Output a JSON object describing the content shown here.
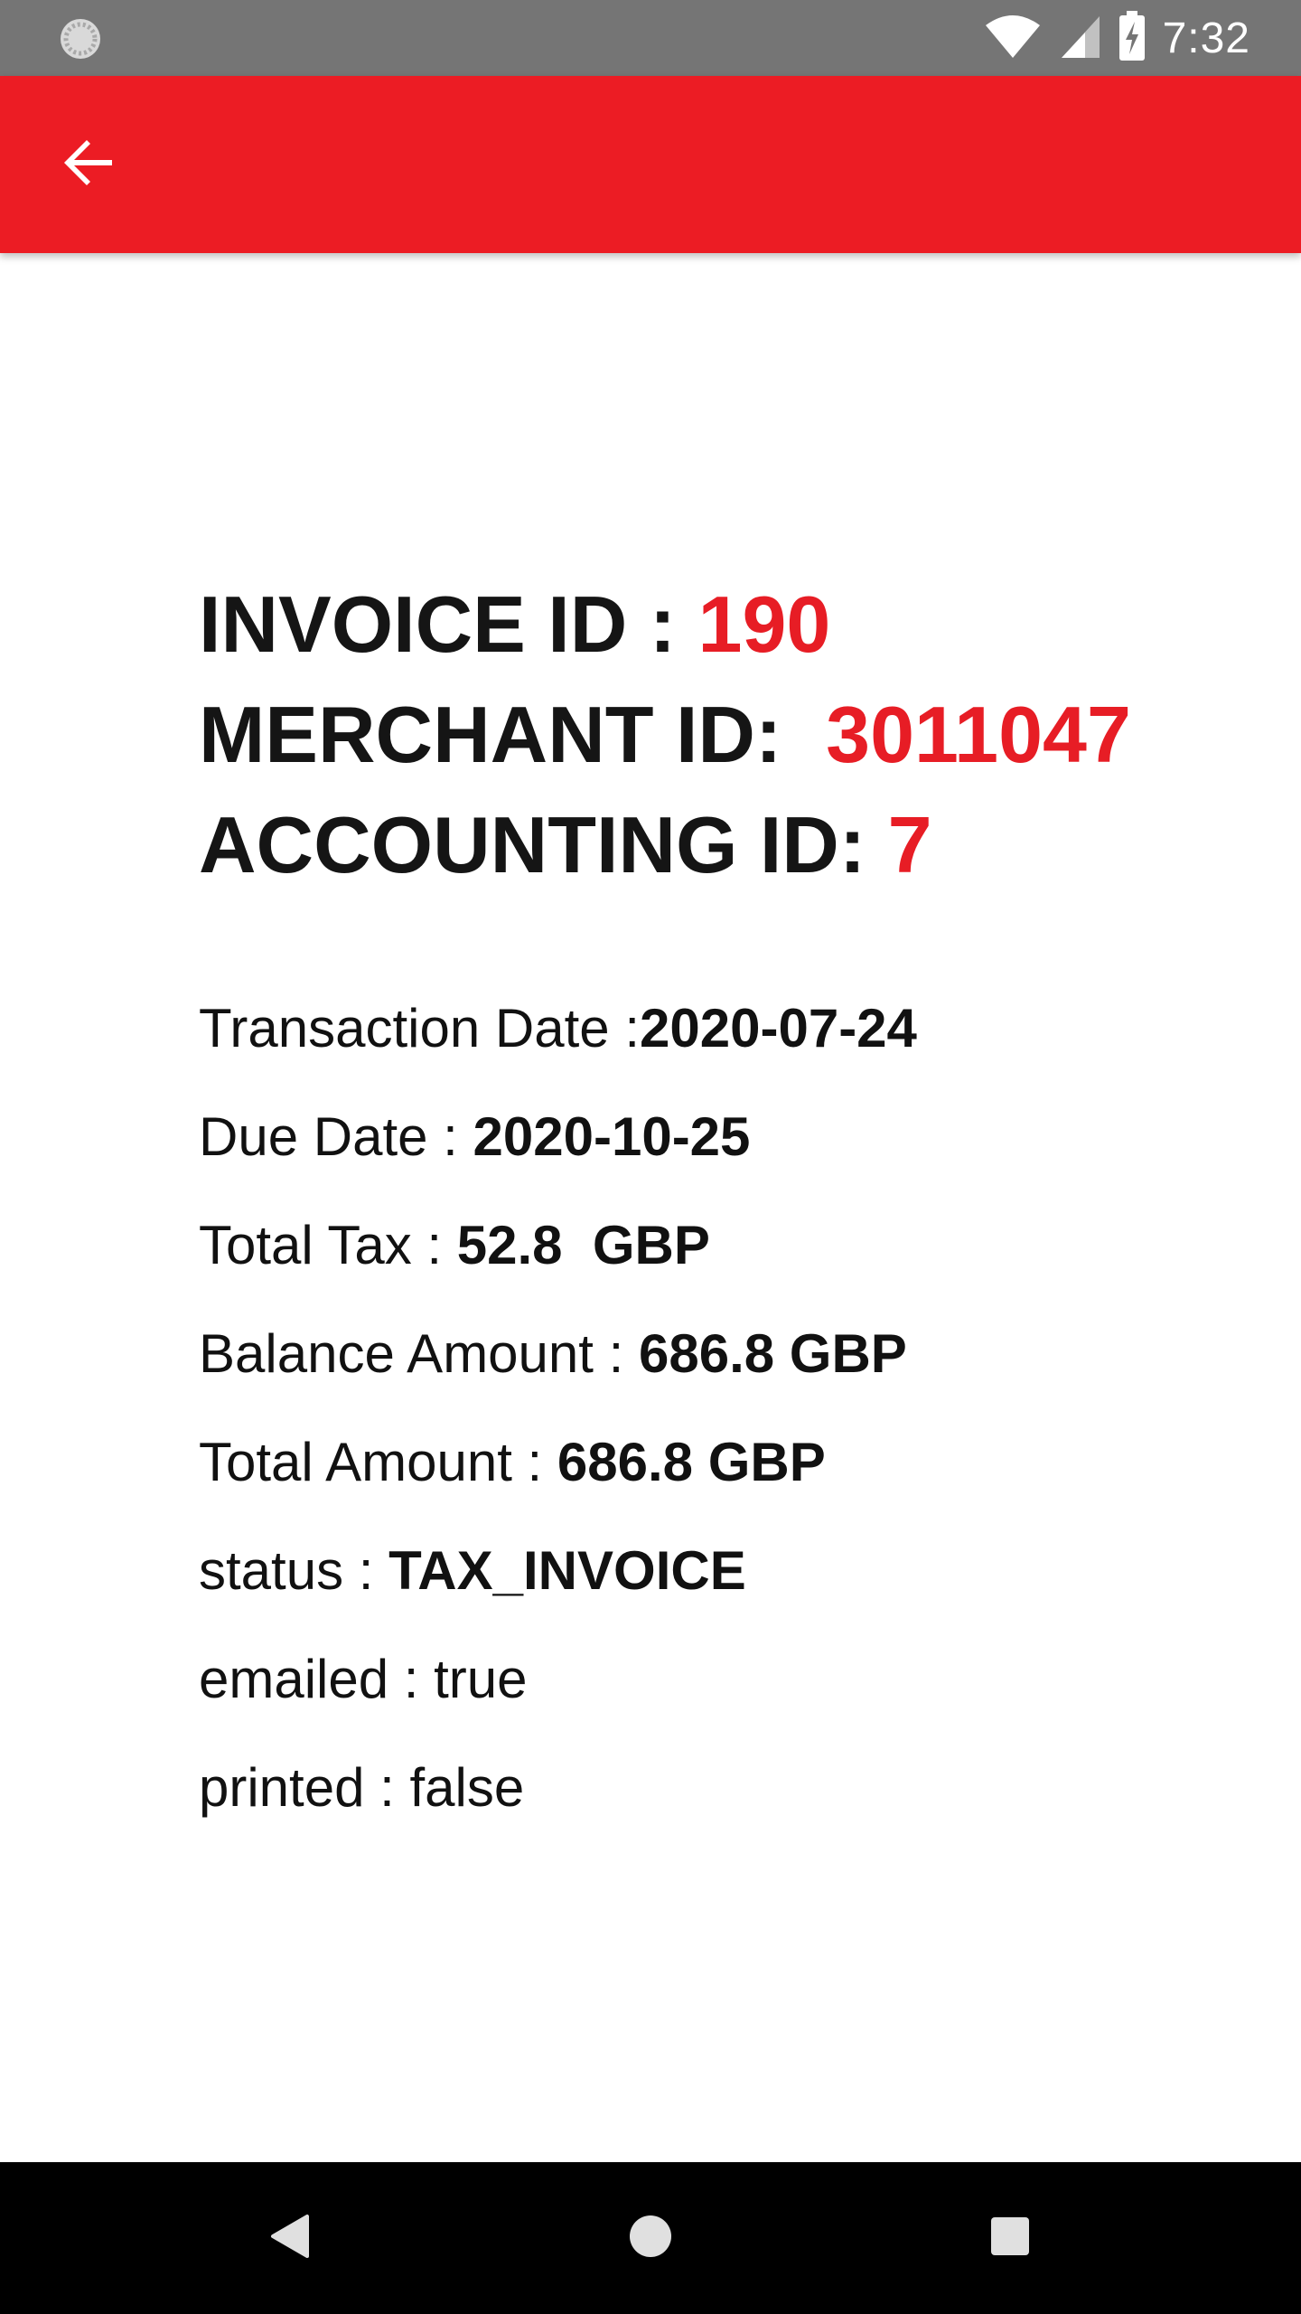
{
  "status_bar": {
    "time": "7:32",
    "icons": [
      "loading-icon",
      "wifi-icon",
      "signal-icon",
      "battery-charging-icon"
    ]
  },
  "app_bar": {
    "color": "#ec1c24",
    "back_icon": "arrow-back-icon"
  },
  "header": {
    "invoice_label": "INVOICE ID : ",
    "invoice_value": "190",
    "merchant_label": "MERCHANT ID:  ",
    "merchant_value": "3011047",
    "accounting_label": "ACCOUNTING ID: ",
    "accounting_value": "7",
    "accent_color": "#e71d25"
  },
  "details": {
    "transaction_date_label": "Transaction Date :",
    "transaction_date_value": "2020-07-24",
    "due_date_label": "Due Date : ",
    "due_date_value": "2020-10-25",
    "total_tax_label": "Total Tax : ",
    "total_tax_value": "52.8  GBP",
    "balance_amount_label": "Balance Amount : ",
    "balance_amount_value": "686.8 GBP",
    "total_amount_label": "Total Amount : ",
    "total_amount_value": "686.8 GBP",
    "status_label": "status : ",
    "status_value": "TAX_INVOICE",
    "emailed_label": "emailed : ",
    "emailed_value": "true",
    "printed_label": "printed : ",
    "printed_value": "false"
  },
  "nav_bar": {
    "icons": [
      "back-triangle-icon",
      "home-circle-icon",
      "recents-square-icon"
    ]
  }
}
